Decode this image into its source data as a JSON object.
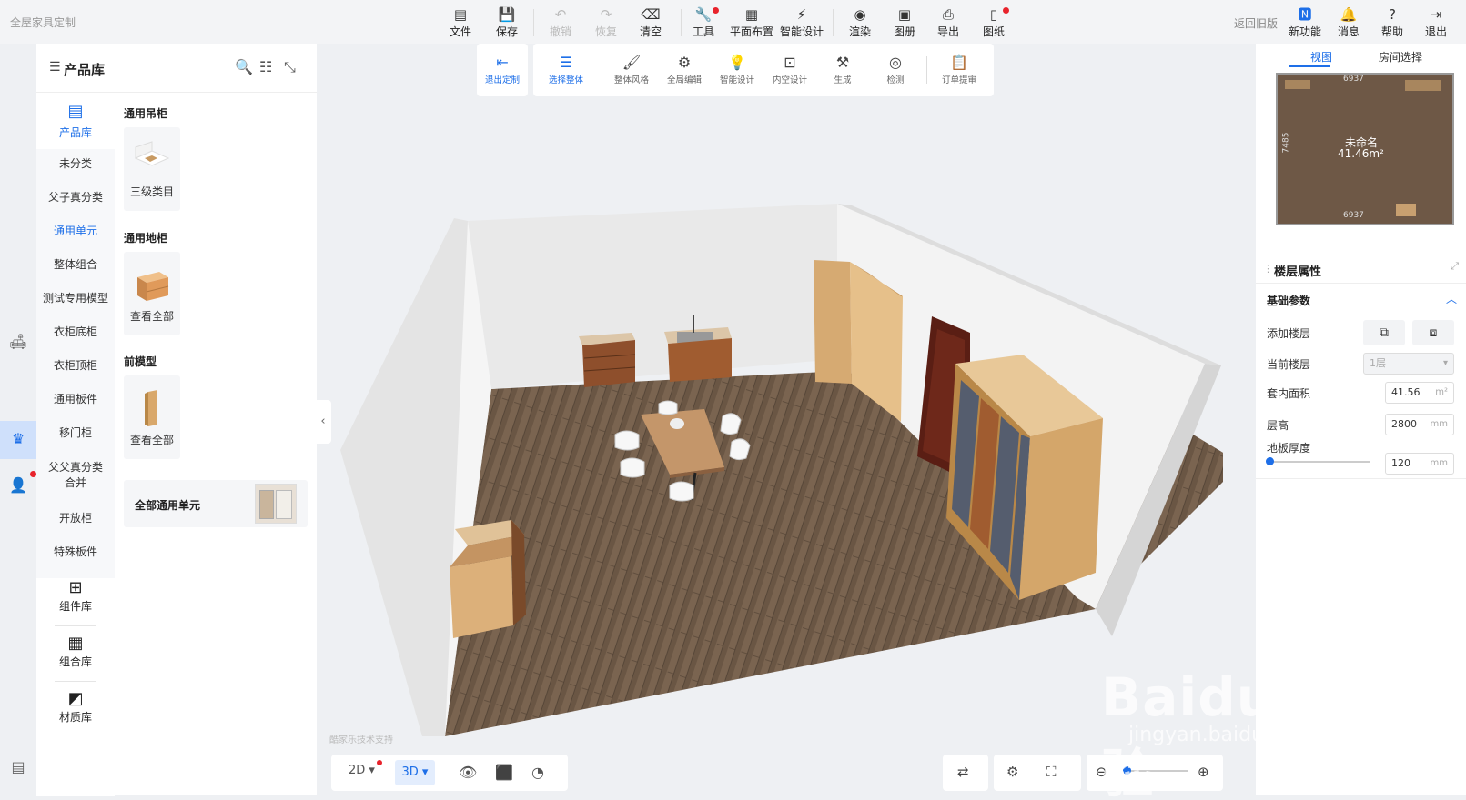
{
  "app": {
    "brand": "全屋家具定制",
    "back_old": "返回旧版"
  },
  "toolbar": {
    "file": "文件",
    "save": "保存",
    "undo": "撤销",
    "redo": "恢复",
    "clear": "清空",
    "tools": "工具",
    "floor_plan": "平面布置",
    "smart_design": "智能设计",
    "render": "渲染",
    "album": "图册",
    "export": "导出",
    "drawings": "图纸",
    "new_features": "新功能",
    "messages": "消息",
    "help": "帮助",
    "logout": "退出"
  },
  "subtoolbar": {
    "exit_custom": "退出定制",
    "select_all": "选择整体",
    "overall_style": "整体风格",
    "global_edit": "全局编辑",
    "smart_design": "智能设计",
    "interior_design": "内空设计",
    "generate": "生成",
    "detect": "检测",
    "order_review": "订单提审"
  },
  "library": {
    "title": "产品库",
    "main_tab": "产品库",
    "categories": [
      "未分类",
      "父子真分类",
      "通用单元",
      "整体组合",
      "测试专用模型",
      "衣柜底柜",
      "衣柜顶柜",
      "通用板件",
      "移门柜",
      "父父真分类合并",
      "开放柜",
      "特殊板件"
    ],
    "active_category": "通用单元",
    "component_lib": "组件库",
    "combo_lib": "组合库",
    "material_lib": "材质库",
    "sections": [
      {
        "title": "通用吊柜",
        "card_label": "三级类目"
      },
      {
        "title": "通用地柜",
        "card_label": "查看全部"
      },
      {
        "title": "前模型",
        "card_label": "查看全部"
      }
    ],
    "all_units": "全部通用单元"
  },
  "viewport": {
    "tech_support": "酷家乐技术支持"
  },
  "view_controls": {
    "mode_2d": "2D",
    "mode_3d": "3D"
  },
  "right_panel": {
    "tab_view": "视图",
    "tab_room": "房间选择",
    "minimap": {
      "room_name": "未命名",
      "room_area": "41.46m²",
      "dim_top": "6937",
      "dim_bottom": "6937",
      "dim_side": "7485"
    },
    "floor_props_title": "楼层属性",
    "basic_params": "基础参数",
    "add_floor": "添加楼层",
    "current_floor": "当前楼层",
    "current_floor_value": "1层",
    "inner_area": "套内面积",
    "inner_area_value": "41.56",
    "inner_area_unit": "m²",
    "floor_height": "层高",
    "floor_height_value": "2800",
    "floor_height_unit": "mm",
    "slab_thickness": "地板厚度",
    "slab_thickness_value": "120",
    "slab_thickness_unit": "mm"
  },
  "watermark": {
    "brand": "Baidu经验",
    "url": "jingyan.baidu.com"
  },
  "colors": {
    "accent": "#1e6fe8",
    "notify": "#e8232c",
    "floor_wood": "#7a6450"
  }
}
